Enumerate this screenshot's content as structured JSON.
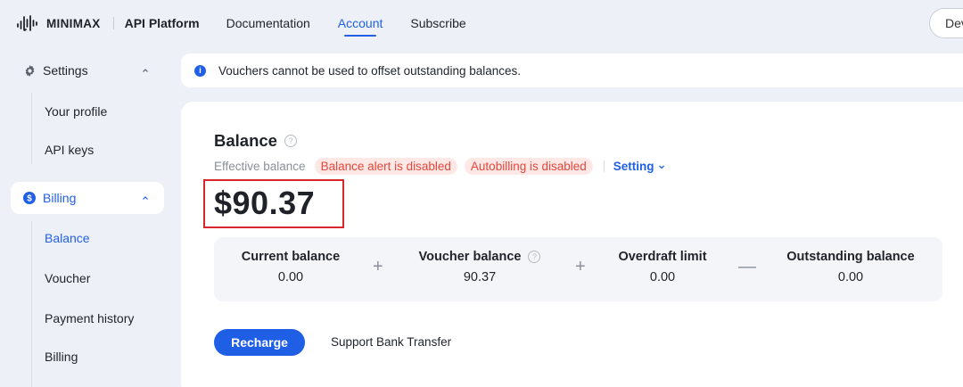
{
  "brand": {
    "logo_text": "MINIMAX",
    "platform": "API Platform",
    "accent_color": "#2160e6"
  },
  "nav": {
    "items": [
      {
        "label": "Documentation",
        "active": false
      },
      {
        "label": "Account",
        "active": true
      },
      {
        "label": "Subscribe",
        "active": false
      }
    ],
    "right_button": "Dev"
  },
  "sidebar": {
    "settings": {
      "label": "Settings",
      "icon": "gear-icon",
      "items": [
        "Your profile",
        "API keys"
      ]
    },
    "billing": {
      "label": "Billing",
      "icon": "dollar-icon",
      "items": [
        "Balance",
        "Voucher",
        "Payment history",
        "Billing"
      ],
      "active_item": "Balance"
    }
  },
  "notice": {
    "text": "Vouchers cannot be used to offset outstanding balances."
  },
  "balance": {
    "title": "Balance",
    "effective_label": "Effective balance",
    "tags": [
      "Balance alert is disabled",
      "Autobilling is disabled"
    ],
    "setting_label": "Setting",
    "amount": "$90.37",
    "summary": {
      "current": {
        "label": "Current balance",
        "value": "0.00"
      },
      "voucher": {
        "label": "Voucher balance",
        "value": "90.37"
      },
      "overdraft": {
        "label": "Overdraft limit",
        "value": "0.00"
      },
      "outstanding": {
        "label": "Outstanding balance",
        "value": "0.00"
      },
      "ops": [
        "+",
        "+",
        "—"
      ]
    },
    "recharge_label": "Recharge",
    "bank_transfer_label": "Support Bank Transfer"
  }
}
